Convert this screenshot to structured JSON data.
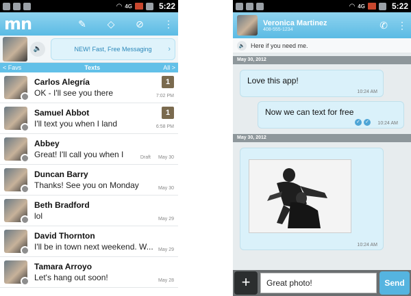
{
  "status_bar": {
    "network": "4G",
    "time": "5:22"
  },
  "left": {
    "logo": "mn",
    "promo_text": "NEW! Fast, Free Messaging",
    "tabs": {
      "prev": "< Favs",
      "current": "Texts",
      "next": "All >"
    },
    "conversations": [
      {
        "name": "Carlos Alegría",
        "message": "OK - I'll see you there",
        "time": "7:02 PM",
        "unread": "1",
        "draft": ""
      },
      {
        "name": "Samuel Abbot",
        "message": "I'll text you when I land",
        "time": "6:58 PM",
        "unread": "1",
        "draft": ""
      },
      {
        "name": "Abbey",
        "message": "Great! I'll call you when I",
        "time": "May 30",
        "unread": "",
        "draft": "Draft"
      },
      {
        "name": "Duncan Barry",
        "message": "Thanks! See you on Monday",
        "time": "May 30",
        "unread": "",
        "draft": ""
      },
      {
        "name": "Beth Bradford",
        "message": "lol",
        "time": "May 29",
        "unread": "",
        "draft": ""
      },
      {
        "name": "David Thornton",
        "message": "I'll be in town next weekend. W...",
        "time": "May 29",
        "unread": "",
        "draft": ""
      },
      {
        "name": "Tamara Arroyo",
        "message": "Let's hang out soon!",
        "time": "May 28",
        "unread": "",
        "draft": ""
      }
    ]
  },
  "right": {
    "contact_name": "Veronica Martinez",
    "contact_number": "408-555-1234",
    "status_message": "Here if you need me.",
    "date_1": "May 30, 2012",
    "date_2": "May 30, 2012",
    "messages": [
      {
        "text": "Love this app!",
        "time": "10:24 AM"
      },
      {
        "text": "Now we can text for free",
        "time": "10:24 AM"
      },
      {
        "text": "",
        "time": "10:24 AM"
      }
    ],
    "compose_value": "Great photo!",
    "send_label": "Send"
  },
  "colors": {
    "header_blue": "#5bbbe4",
    "bubble": "#daf1fa",
    "send": "#55b4e0"
  }
}
